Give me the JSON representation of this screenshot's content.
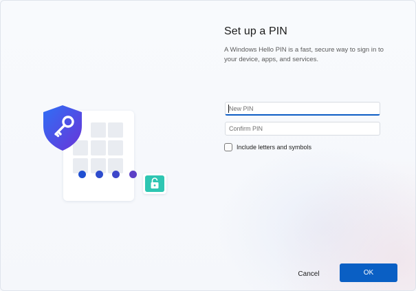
{
  "dialog": {
    "title": "Set up a PIN",
    "description": "A Windows Hello PIN is a fast, secure way to sign in to your device, apps, and services."
  },
  "form": {
    "new_pin_placeholder": "New PIN",
    "new_pin_value": "",
    "confirm_pin_placeholder": "Confirm PIN",
    "confirm_pin_value": "",
    "include_letters_label": "Include letters and symbols",
    "include_letters_checked": false
  },
  "buttons": {
    "cancel_label": "Cancel",
    "ok_label": "OK"
  },
  "illustration": {
    "icons": [
      "shield-key-icon",
      "keypad-icon",
      "unlock-icon"
    ],
    "pin_dot_colors": [
      "#1f4fd1",
      "#2d4ccd",
      "#3d46c9",
      "#5b3fc6"
    ],
    "shield_colors": [
      "#2f6ff5",
      "#6a34d8"
    ],
    "lock_color": "#2ec6b2"
  },
  "colors": {
    "accent": "#0a5fc4",
    "background": "#f7f9fc"
  }
}
